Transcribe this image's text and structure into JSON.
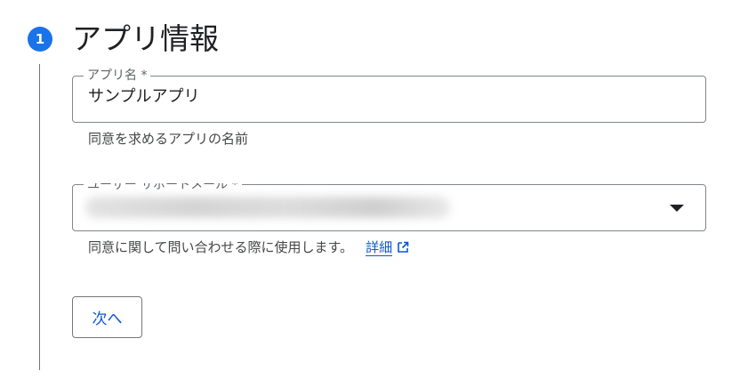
{
  "step": {
    "number": "1",
    "title": "アプリ情報"
  },
  "app_name_field": {
    "label": "アプリ名 *",
    "value": "サンプルアプリ",
    "helper": "同意を求めるアプリの名前"
  },
  "support_email_field": {
    "label": "ユーザー サポートメール *",
    "value_obscured": true,
    "helper": "同意に関して問い合わせる際に使用します。",
    "details_link": "詳細"
  },
  "next_button": {
    "label": "次へ"
  },
  "colors": {
    "accent": "#1a73e8",
    "link": "#0b57d0",
    "border": "#80868b"
  },
  "icons": {
    "dropdown": "caret-down-icon",
    "external": "open-in-new-icon"
  }
}
